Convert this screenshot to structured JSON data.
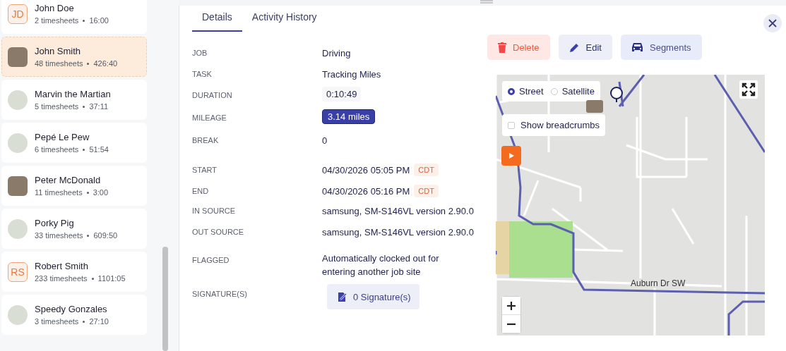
{
  "sidebar": {
    "employees": [
      {
        "name": "John Doe",
        "timesheets": "2 timesheets",
        "hours": "16:00",
        "selected": false,
        "avatar": {
          "kind": "initials",
          "initials": "JD"
        }
      },
      {
        "name": "John Smith",
        "timesheets": "48 timesheets",
        "hours": "426:40",
        "selected": true,
        "avatar": {
          "kind": "photo"
        }
      },
      {
        "name": "Marvin the Martian",
        "timesheets": "5 timesheets",
        "hours": "37:11",
        "selected": false,
        "avatar": {
          "kind": "cartoon"
        }
      },
      {
        "name": "Pepé Le Pew",
        "timesheets": "6 timesheets",
        "hours": "51:54",
        "selected": false,
        "avatar": {
          "kind": "cartoon"
        }
      },
      {
        "name": "Peter McDonald",
        "timesheets": "11 timesheets",
        "hours": "3:00",
        "selected": false,
        "avatar": {
          "kind": "photo"
        }
      },
      {
        "name": "Porky Pig",
        "timesheets": "33 timesheets",
        "hours": "609:50",
        "selected": false,
        "avatar": {
          "kind": "cartoon"
        }
      },
      {
        "name": "Robert Smith",
        "timesheets": "233 timesheets",
        "hours": "1101:05",
        "selected": false,
        "avatar": {
          "kind": "initials",
          "initials": "RS"
        }
      },
      {
        "name": "Speedy Gonzales",
        "timesheets": "3 timesheets",
        "hours": "27:10",
        "selected": false,
        "avatar": {
          "kind": "cartoon"
        }
      }
    ]
  },
  "tabs": [
    {
      "label": "Details",
      "selected": true
    },
    {
      "label": "Activity History",
      "selected": false
    }
  ],
  "details": [
    {
      "label": "JOB",
      "kind": "text",
      "value": "Driving"
    },
    {
      "label": "TASK",
      "kind": "text",
      "value": "Tracking Miles"
    },
    {
      "label": "DURATION",
      "kind": "chip",
      "value": "0:10:49"
    },
    {
      "label": "MILEAGE",
      "kind": "badge",
      "value": "3.14 miles"
    },
    {
      "label": "BREAK",
      "kind": "text",
      "value": "0"
    },
    {
      "label": "START",
      "kind": "datetime",
      "value": "04/30/2026 05:05 PM",
      "zone": "CDT"
    },
    {
      "label": "END",
      "kind": "datetime",
      "value": "04/30/2026 05:16 PM",
      "zone": "CDT"
    },
    {
      "label": "IN SOURCE",
      "kind": "text",
      "value": "samsung, SM-S146VL version 2.90.0"
    },
    {
      "label": "OUT SOURCE",
      "kind": "text",
      "value": "samsung, SM-S146VL version 2.90.0"
    },
    {
      "label": "FLAGGED",
      "kind": "wrap",
      "value": "Automatically clocked out for entering another job site"
    },
    {
      "label": "SIGNATURE(S)",
      "kind": "button",
      "value": "0 Signature(s)"
    }
  ],
  "actions": [
    {
      "kind": "delete",
      "label": "Delete"
    },
    {
      "kind": "edit",
      "label": "Edit"
    },
    {
      "kind": "segments",
      "label": "Segments"
    }
  ],
  "map": {
    "layers": [
      {
        "label": "Street",
        "selected": true
      },
      {
        "label": "Satellite",
        "selected": false
      }
    ],
    "breadcrumbs": {
      "label": "Show breadcrumbs",
      "checked": false
    },
    "street_label": "Auburn Dr SW"
  }
}
